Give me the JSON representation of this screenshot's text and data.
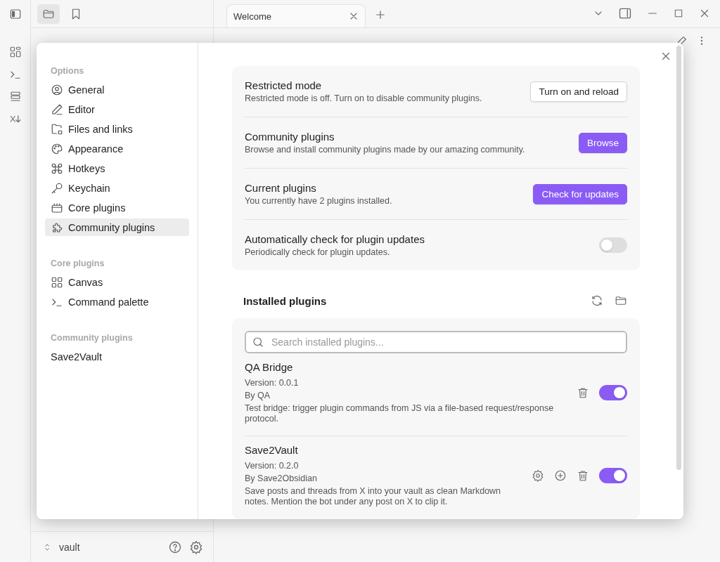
{
  "tab": {
    "title": "Welcome"
  },
  "settings": {
    "nav_sections": [
      {
        "heading": "Options",
        "items": [
          {
            "label": "General",
            "selected": false
          },
          {
            "label": "Editor",
            "selected": false
          },
          {
            "label": "Files and links",
            "selected": false
          },
          {
            "label": "Appearance",
            "selected": false
          },
          {
            "label": "Hotkeys",
            "selected": false
          },
          {
            "label": "Keychain",
            "selected": false
          },
          {
            "label": "Core plugins",
            "selected": false
          },
          {
            "label": "Community plugins",
            "selected": true
          }
        ]
      },
      {
        "heading": "Core plugins",
        "items": [
          {
            "label": "Canvas",
            "selected": false
          },
          {
            "label": "Command palette",
            "selected": false
          }
        ]
      },
      {
        "heading": "Community plugins",
        "items": [
          {
            "label": "Save2Vault",
            "selected": false
          }
        ]
      }
    ],
    "rows": [
      {
        "kind": "button",
        "title": "Restricted mode",
        "description": "Restricted mode is off. Turn on to disable community plugins.",
        "button": "Turn on and reload",
        "primary": false
      },
      {
        "kind": "button",
        "title": "Community plugins",
        "description": "Browse and install community plugins made by our amazing community.",
        "button": "Browse",
        "primary": true
      },
      {
        "kind": "button",
        "title": "Current plugins",
        "description": "You currently have 2 plugins installed.",
        "button": "Check for updates",
        "primary": true
      },
      {
        "kind": "toggle",
        "title": "Automatically check for plugin updates",
        "description": "Periodically check for plugin updates.",
        "on": false
      }
    ],
    "installed_heading": "Installed plugins",
    "search": {
      "placeholder": "Search installed plugins..."
    },
    "plugins": [
      {
        "name": "QA Bridge",
        "version": "Version: 0.0.1",
        "author": "By QA",
        "description": "Test bridge: trigger plugin commands from JS via a file-based request/response protocol.",
        "has_settings": false,
        "has_hotkeys": false,
        "enabled": true
      },
      {
        "name": "Save2Vault",
        "version": "Version: 0.2.0",
        "author": "By Save2Obsidian",
        "description": "Save posts and threads from X into your vault as clean Markdown notes. Mention the bot under any post on X to clip it.",
        "has_settings": true,
        "has_hotkeys": true,
        "enabled": true
      }
    ]
  },
  "vault": {
    "name": "vault"
  }
}
